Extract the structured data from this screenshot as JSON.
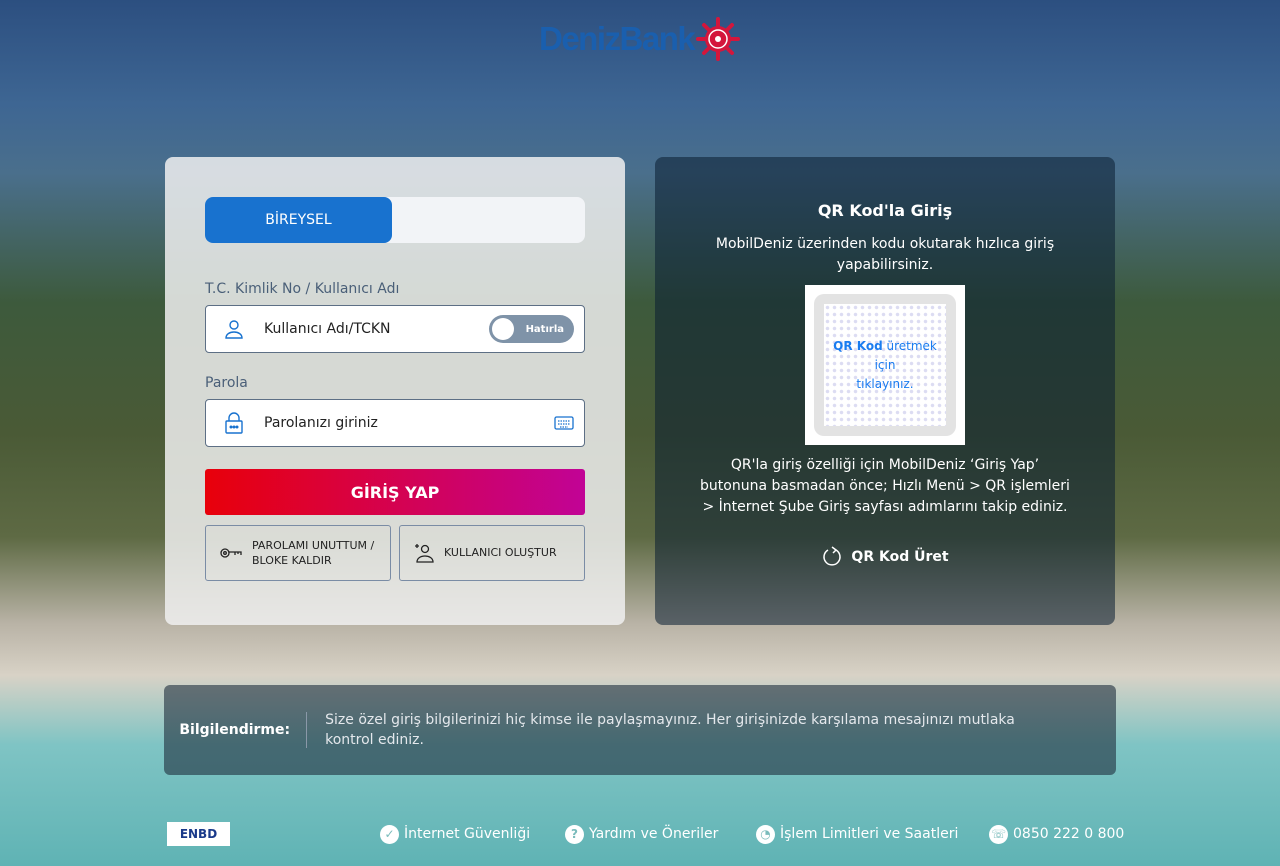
{
  "brand": {
    "name": "DenizBank"
  },
  "login": {
    "tab_individual": "BİREYSEL",
    "username_label": "T.C. Kimlik No / Kullanıcı Adı",
    "username_placeholder": "Kullanıcı Adı/TCKN",
    "remember_label": "Hatırla",
    "password_label": "Parola",
    "password_placeholder": "Parolanızı giriniz",
    "login_button": "GİRİŞ YAP",
    "forgot_line1": "PAROLAMI UNUTTUM /",
    "forgot_line2": "BLOKE KALDIR",
    "create_user": "KULLANICI OLUŞTUR"
  },
  "qr": {
    "title": "QR Kod'la Giriş",
    "description": "MobilDeniz üzerinden kodu okutarak hızlıca giriş yapabilirsiniz.",
    "qr_bold": "QR Kod",
    "qr_rest": " üretmek için",
    "qr_line2": "tıklayınız.",
    "info": "QR'la giriş özelliği için MobilDeniz ‘Giriş Yap’ butonuna basmadan önce; Hızlı Menü > QR işlemleri > İnternet Şube Giriş sayfası adımlarını takip ediniz.",
    "generate": "QR Kod Üret"
  },
  "notice": {
    "label": "Bilgilendirme:",
    "text": "Size özel giriş bilgilerinizi hiç kimse ile paylaşmayınız. Her girişinizde karşılama mesajınızı mutlaka kontrol ediniz."
  },
  "footer": {
    "enbd": "ENBD",
    "security": "İnternet Güvenliği",
    "help": "Yardım ve Öneriler",
    "limits": "İşlem Limitleri ve Saatleri",
    "phone": "0850 222 0 800"
  }
}
